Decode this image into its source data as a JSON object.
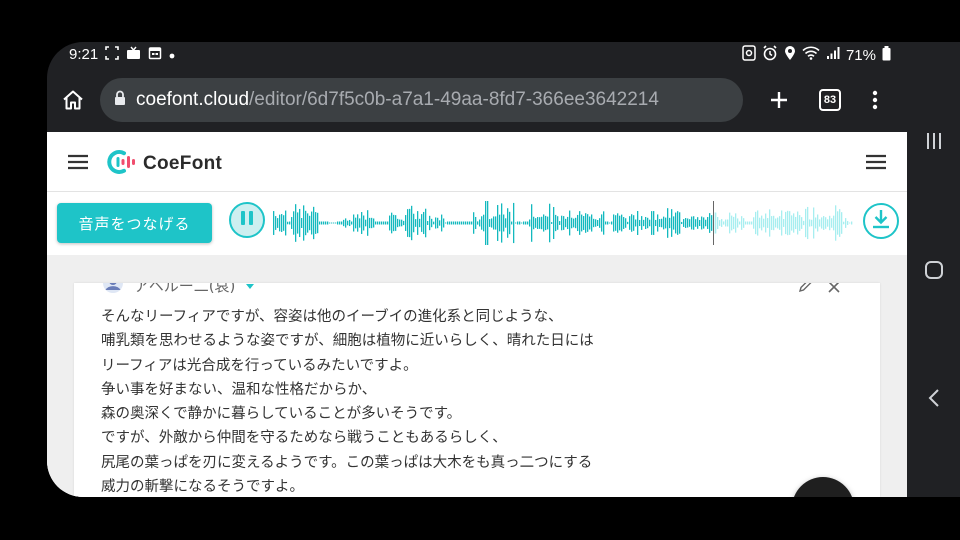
{
  "status_bar": {
    "time": "9:21",
    "battery_percent": "71%"
  },
  "browser": {
    "url_host": "coefont.cloud",
    "url_path": "/editor/6d7f5c0b-a7a1-49aa-8fd7-366ee3642214",
    "tab_count": "83"
  },
  "app": {
    "brand": "CoeFont",
    "brand_color": "#1ec4c8",
    "connect_button": "音声をつなげる",
    "speaker_name": "アヘルー二(哀)",
    "text_lines": [
      "そんなリーフィアですが、容姿は他のイーブイの進化系と同じような、",
      "哺乳類を思わせるような姿ですが、細胞は植物に近いらしく、晴れた日には",
      "リーフィアは光合成を行っているみたいですよ。",
      "争い事を好まない、温和な性格だからか、",
      "森の奥深くで静かに暮らしていることが多いそうです。",
      "ですが、外敵から仲間を守るためなら戦うこともあるらしく、",
      "尻尾の葉っぱを刃に変えるようです。この葉っぱは大木をも真っ二つにする",
      "威力の斬撃になるそうですよ。"
    ],
    "help_button": "?"
  }
}
